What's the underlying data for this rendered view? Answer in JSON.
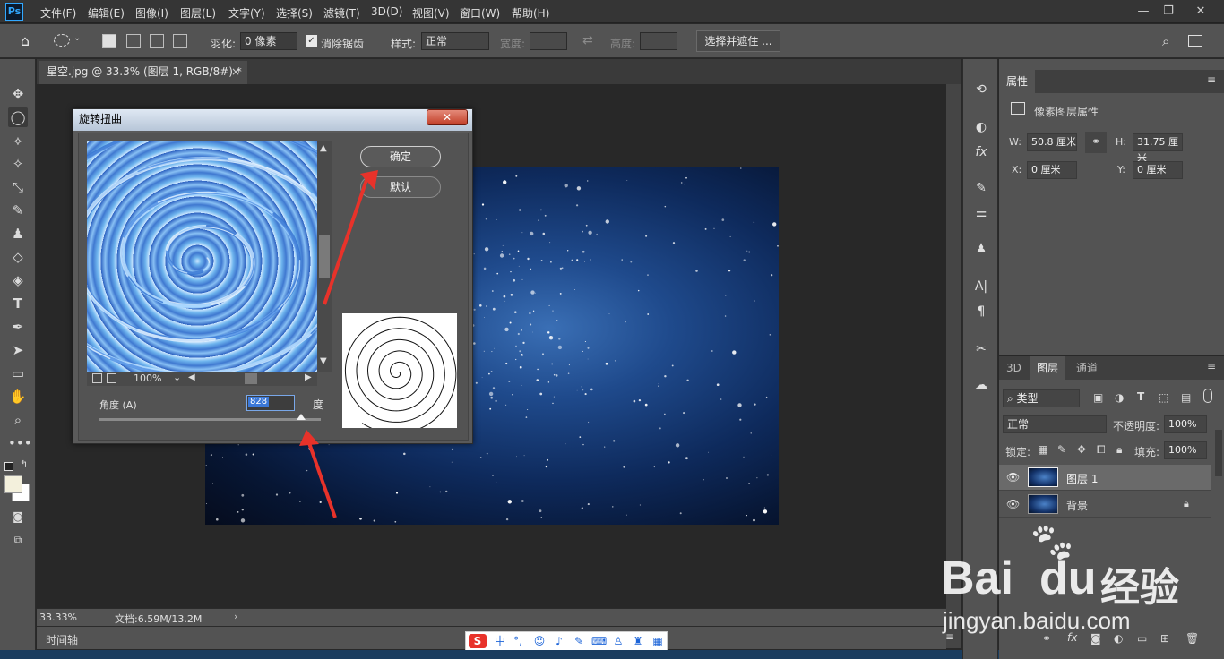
{
  "app": {
    "logo": "Ps",
    "menu": [
      "文件(F)",
      "编辑(E)",
      "图像(I)",
      "图层(L)",
      "文字(Y)",
      "选择(S)",
      "滤镜(T)",
      "3D(D)",
      "视图(V)",
      "窗口(W)",
      "帮助(H)"
    ],
    "window_controls": [
      "—",
      "❐",
      "✕"
    ]
  },
  "options": {
    "feather_label": "羽化:",
    "feather_value": "0 像素",
    "antialias_label": "消除锯齿",
    "style_label": "样式:",
    "style_value": "正常",
    "width_label": "宽度:",
    "height_label": "高度:",
    "select_mask_button": "选择并遮住 ..."
  },
  "document": {
    "tab_title": "星空.jpg @ 33.3% (图层 1, RGB/8#) *",
    "zoom": "33.33%",
    "doc_info": "文档:6.59M/13.2M",
    "timeline_label": "时间轴"
  },
  "dialog": {
    "title": "旋转扭曲",
    "ok_button": "确定",
    "default_button": "默认",
    "preview_zoom": "100%",
    "angle_label": "角度 (A)",
    "angle_value": "828",
    "angle_unit": "度",
    "angle_slider_fraction": 0.91
  },
  "properties": {
    "tab": "属性",
    "header": "像素图层属性",
    "w_label": "W:",
    "w_value": "50.8 厘米",
    "h_label": "H:",
    "h_value": "31.75 厘米",
    "x_label": "X:",
    "x_value": "0 厘米",
    "y_label": "Y:",
    "y_value": "0 厘米"
  },
  "layers": {
    "tabs": [
      "3D",
      "图层",
      "通道"
    ],
    "filter_kind": "类型",
    "blend_mode": "正常",
    "opacity_label": "不透明度:",
    "opacity_value": "100%",
    "lock_label": "锁定:",
    "fill_label": "填充:",
    "fill_value": "100%",
    "items": [
      {
        "name": "图层 1",
        "selected": true
      },
      {
        "name": "背景",
        "locked": true
      }
    ]
  },
  "watermark": {
    "brand_en": "Bai",
    "brand_du": "du",
    "brand_cn": "经验",
    "url": "jingyan.baidu.com"
  },
  "colors": {
    "accent_blue": "#31a8ff",
    "annotation_red": "#e8322a"
  }
}
